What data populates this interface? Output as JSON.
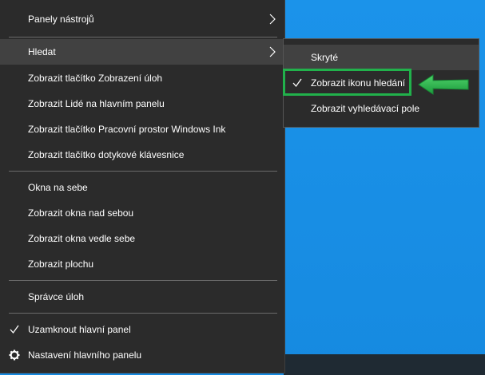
{
  "menu": {
    "items": [
      {
        "label": "Panely nástrojů",
        "submenu": true
      },
      {
        "label": "Hledat",
        "submenu": true
      },
      {
        "label": "Zobrazit tlačítko Zobrazení úloh"
      },
      {
        "label": "Zobrazit Lidé na hlavním panelu"
      },
      {
        "label": "Zobrazit tlačítko Pracovní prostor Windows Ink"
      },
      {
        "label": "Zobrazit tlačítko dotykové klávesnice"
      },
      {
        "label": "Okna na sebe"
      },
      {
        "label": "Zobrazit okna nad sebou"
      },
      {
        "label": "Zobrazit okna vedle sebe"
      },
      {
        "label": "Zobrazit plochu"
      },
      {
        "label": "Správce úloh"
      },
      {
        "label": "Uzamknout hlavní panel",
        "checked": true
      },
      {
        "label": "Nastavení hlavního panelu",
        "icon": "gear-icon"
      }
    ]
  },
  "submenu": {
    "items": [
      {
        "label": "Skryté"
      },
      {
        "label": "Zobrazit ikonu hledání",
        "checked": true
      },
      {
        "label": "Zobrazit vyhledávací pole"
      }
    ]
  },
  "colors": {
    "menu_bg": "#2b2b2b",
    "hover_bg": "#414141",
    "desktop": "#1b93ea",
    "highlight": "#21b14b"
  }
}
